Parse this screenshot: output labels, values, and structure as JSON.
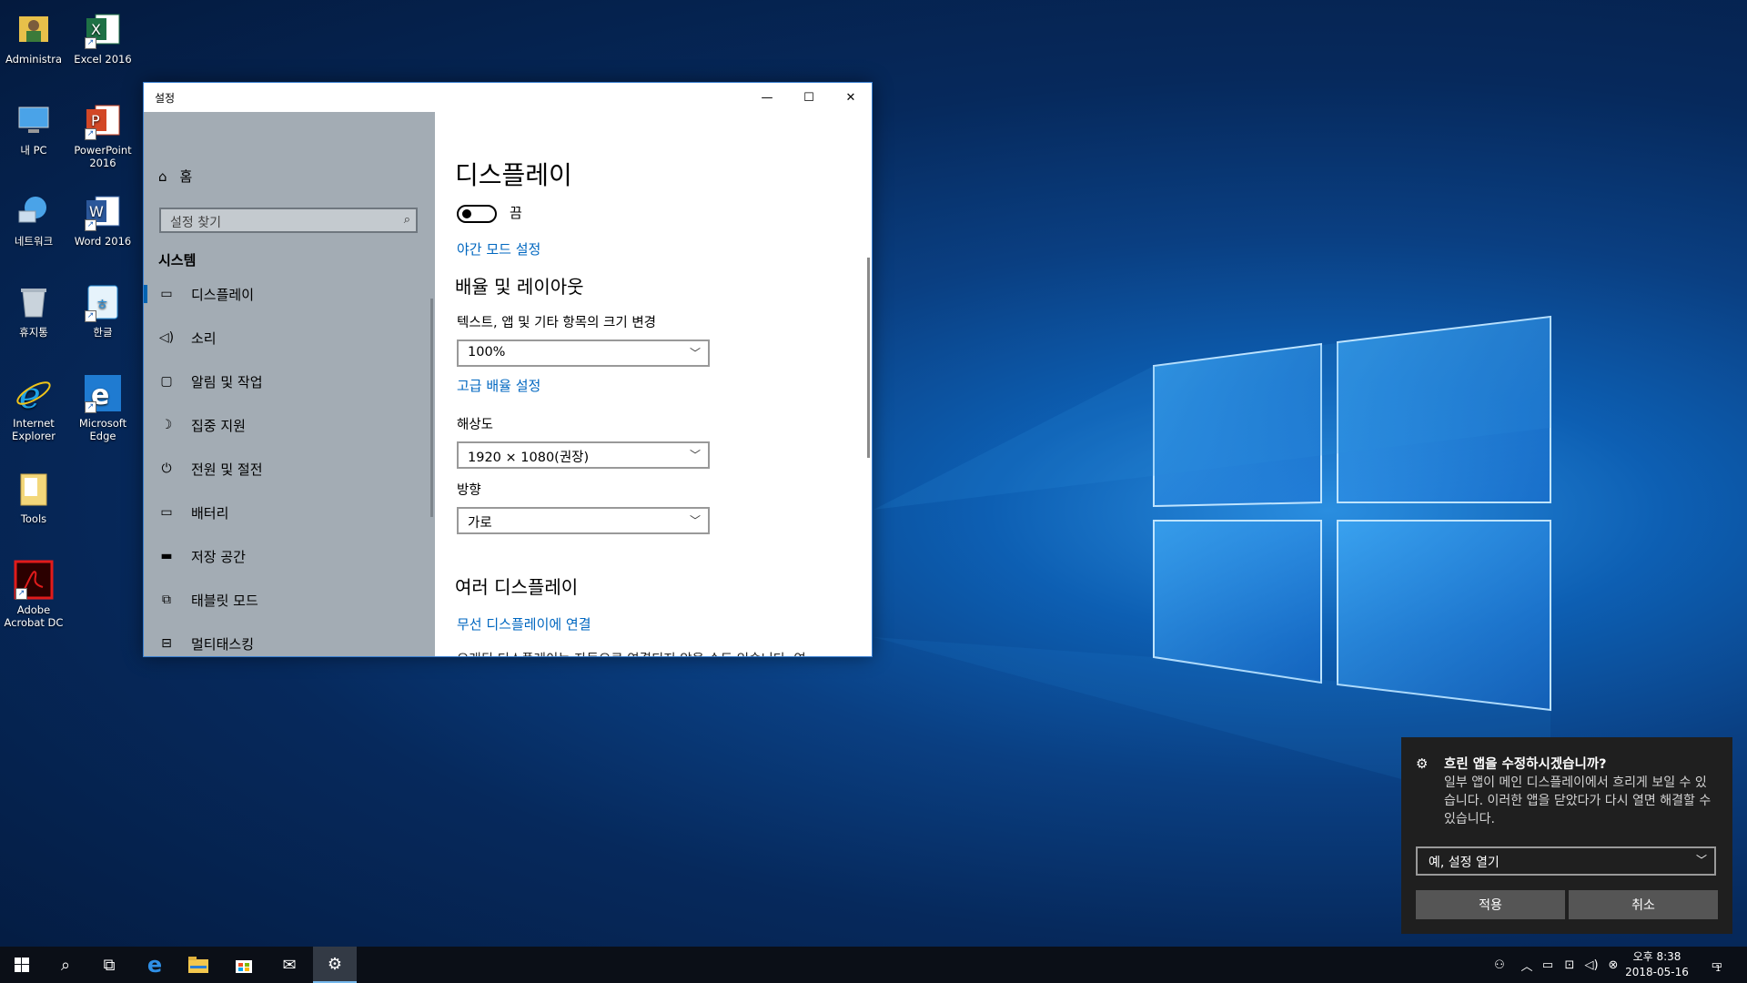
{
  "desktop": {
    "icons": [
      {
        "label": "Administra",
        "icon": "user-folder-icon"
      },
      {
        "label": "Excel 2016",
        "icon": "excel-icon"
      },
      {
        "label": "내 PC",
        "icon": "computer-icon"
      },
      {
        "label": "PowerPoint 2016",
        "icon": "powerpoint-icon"
      },
      {
        "label": "네트워크",
        "icon": "network-icon"
      },
      {
        "label": "Word 2016",
        "icon": "word-icon"
      },
      {
        "label": "휴지통",
        "icon": "recycle-bin-icon"
      },
      {
        "label": "한글",
        "icon": "hangul-icon"
      },
      {
        "label": "Internet Explorer",
        "icon": "ie-icon"
      },
      {
        "label": "Microsoft Edge",
        "icon": "edge-icon"
      },
      {
        "label": "Tools",
        "icon": "folder-icon"
      },
      {
        "label": "Adobe Acrobat DC",
        "icon": "acrobat-icon"
      }
    ]
  },
  "window": {
    "title": "설정",
    "controls": {
      "minimize": "—",
      "maximize": "☐",
      "close": "✕"
    }
  },
  "sidebar": {
    "home": "홈",
    "search_placeholder": "설정 찾기",
    "section": "시스템",
    "items": [
      {
        "label": "디스플레이",
        "icon": "monitor-icon",
        "selected": true
      },
      {
        "label": "소리",
        "icon": "speaker-icon"
      },
      {
        "label": "알림 및 작업",
        "icon": "notification-icon"
      },
      {
        "label": "집중 지원",
        "icon": "moon-icon"
      },
      {
        "label": "전원 및 절전",
        "icon": "power-icon"
      },
      {
        "label": "배터리",
        "icon": "battery-icon"
      },
      {
        "label": "저장 공간",
        "icon": "storage-icon"
      },
      {
        "label": "태블릿 모드",
        "icon": "tablet-icon"
      },
      {
        "label": "멀티태스킹",
        "icon": "multitask-icon"
      }
    ]
  },
  "content": {
    "heading": "디스플레이",
    "night_light_state": "끔",
    "night_light_link": "야간 모드 설정",
    "scale_heading": "배율 및 레이아웃",
    "scale_label": "텍스트, 앱 및 기타 항목의 크기 변경",
    "scale_value": "100%",
    "advanced_scale_link": "고급 배율 설정",
    "resolution_label": "해상도",
    "resolution_value": "1920 × 1080(권장)",
    "orientation_label": "방향",
    "orientation_value": "가로",
    "multi_heading": "여러 디스플레이",
    "wireless_link": "무선 디스플레이에 연결",
    "footer_text": "오래된 디스플레이는 자동으로 연결되지 않을 수도 있습니다. 연"
  },
  "toast": {
    "title": "흐린 앱을 수정하시겠습니까?",
    "body": "일부 앱이 메인 디스플레이에서 흐리게 보일 수 있습니다. 이러한 앱을 닫았다가 다시 열면 해결할 수 있습니다.",
    "select_value": "예, 설정 열기",
    "apply": "적용",
    "cancel": "취소"
  },
  "taskbar": {
    "time": "오후 8:38",
    "date": "2018-05-16",
    "notification_count": "1"
  },
  "colors": {
    "accent": "#0067c0",
    "sidebar": "#a3acb4",
    "taskbar": "#0b0f17"
  }
}
